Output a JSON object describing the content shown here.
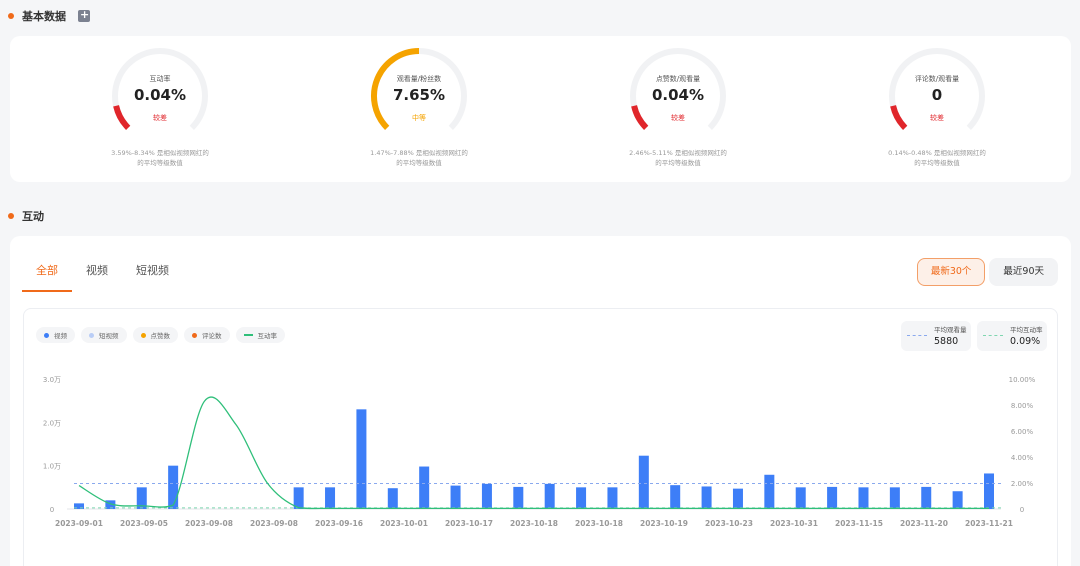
{
  "basic": {
    "title": "基本数据",
    "metrics": [
      {
        "label": "互动率",
        "value": "0.04%",
        "level": "较差",
        "level_color": "#e0262b",
        "arc_color": "#e0262b",
        "fill": 0.12,
        "desc1": "3.59%-8.34% 是相似视频网红的",
        "desc2": "的平均等级数值"
      },
      {
        "label": "观看量/粉丝数",
        "value": "7.65%",
        "level": "中等",
        "level_color": "#f5a300",
        "arc_color": "#f5a300",
        "fill": 0.5,
        "desc1": "1.47%-7.88% 是相似视频网红的",
        "desc2": "的平均等级数值"
      },
      {
        "label": "点赞数/观看量",
        "value": "0.04%",
        "level": "较差",
        "level_color": "#e0262b",
        "arc_color": "#e0262b",
        "fill": 0.12,
        "desc1": "2.46%-5.11% 是相似视频网红的",
        "desc2": "的平均等级数值"
      },
      {
        "label": "评论数/观看量",
        "value": "0",
        "level": "较差",
        "level_color": "#e0262b",
        "arc_color": "#e0262b",
        "fill": 0.12,
        "desc1": "0.14%-0.48% 是相似视频网红的",
        "desc2": "的平均等级数值"
      }
    ]
  },
  "interaction": {
    "title": "互动",
    "tabs": [
      "全部",
      "视频",
      "短视频"
    ],
    "range_buttons": [
      "最新30个",
      "最近90天"
    ],
    "legend": [
      {
        "label": "视频",
        "color": "#3d7ef7",
        "kind": "dot"
      },
      {
        "label": "短视频",
        "color": "#b9cdf6",
        "kind": "dot"
      },
      {
        "label": "点赞数",
        "color": "#f5a300",
        "kind": "dot"
      },
      {
        "label": "评论数",
        "color": "#f06a1a",
        "kind": "dot"
      },
      {
        "label": "互动率",
        "color": "#2fbf7a",
        "kind": "line"
      }
    ],
    "avg_views": {
      "label": "平均观看量",
      "value": "5880",
      "color": "#8aa9ee"
    },
    "avg_rate": {
      "label": "平均互动率",
      "value": "0.09%",
      "color": "#7fd6b0"
    }
  },
  "chart_data": {
    "type": "bar",
    "left_ticks": [
      "0",
      "1.0万",
      "2.0万",
      "3.0万"
    ],
    "right_ticks": [
      "0",
      "2.00%",
      "4.00%",
      "6.00%",
      "8.00%",
      "10.00%"
    ],
    "x_labels": [
      "2023-09-01",
      "2023-09-05",
      "2023-09-08",
      "2023-09-08",
      "2023-09-16",
      "2023-10-01",
      "2023-10-17",
      "2023-10-18",
      "2023-10-18",
      "2023-10-19",
      "2023-10-23",
      "2023-10-31",
      "2023-11-15",
      "2023-11-20",
      "2023-11-21"
    ],
    "ylim_left": [
      0,
      30000
    ],
    "ylim_right": [
      0,
      10
    ],
    "views": [
      1300,
      2000,
      5000,
      10000,
      0,
      0,
      0,
      5000,
      5000,
      23000,
      4800,
      9800,
      5400,
      5800,
      5100,
      5800,
      5000,
      5000,
      12300,
      5500,
      5200,
      4700,
      7900,
      5000,
      5100,
      5000,
      5000,
      5100,
      4100,
      8200
    ],
    "rate": [
      1.8,
      0.4,
      0.25,
      0.3,
      8.3,
      6.5,
      2.0,
      0.1,
      0.05,
      0.05,
      0.05,
      0.05,
      0.05,
      0.05,
      0.05,
      0.05,
      0.05,
      0.05,
      0.05,
      0.05,
      0.05,
      0.05,
      0.05,
      0.05,
      0.05,
      0.05,
      0.05,
      0.05,
      0.05,
      0.05
    ],
    "avg_views": 5880,
    "avg_rate": 0.09
  }
}
